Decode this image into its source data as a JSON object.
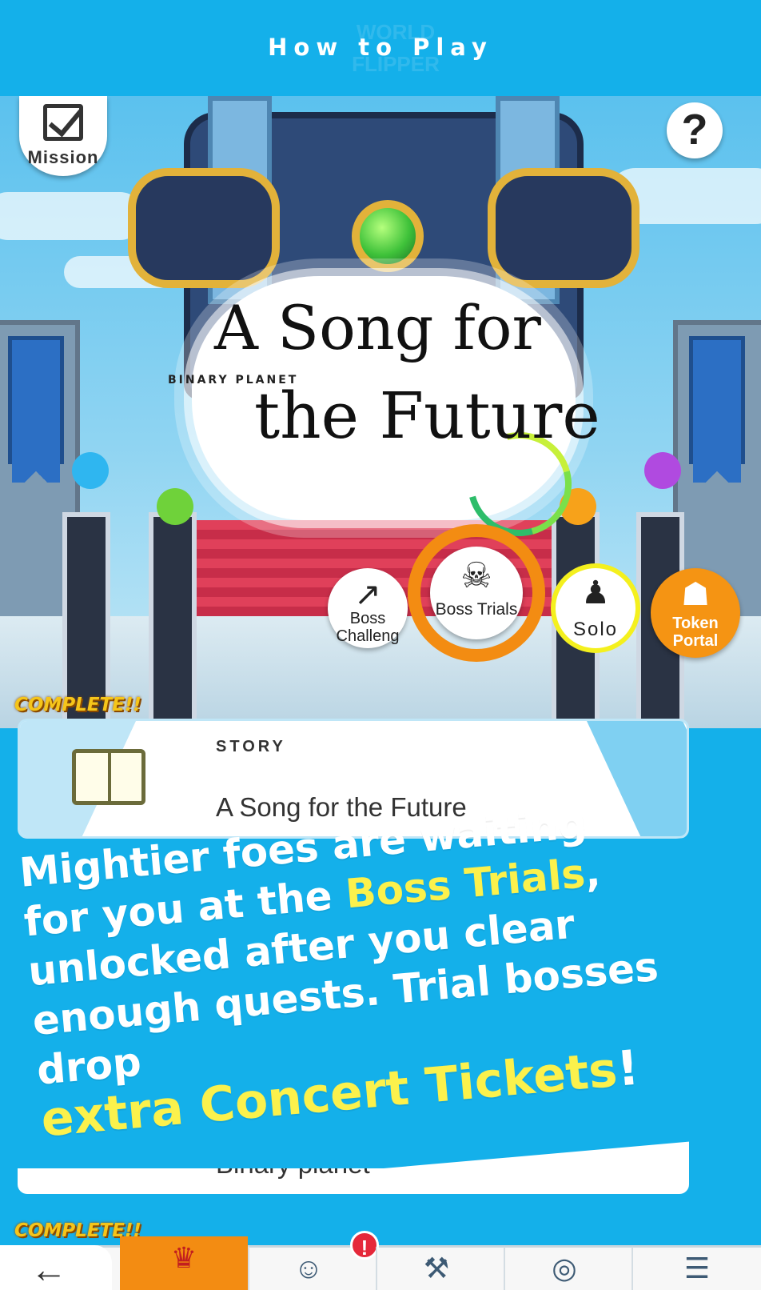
{
  "header": {
    "title": "How to Play",
    "logo_watermark": "WORLD FLIPPER"
  },
  "scene": {
    "mission_label": "Mission",
    "help_icon": "question-icon",
    "title": {
      "line1": "A Song for",
      "subtitle": "BINARY PLANET",
      "line2": "the Future"
    },
    "modes": {
      "boss_challenge": "Boss Challeng",
      "boss_challenge_line1": "Boss",
      "boss_challenge_line2": "Challeng",
      "boss_trials": "Boss Trials",
      "solo": "Solo",
      "token_portal_line1": "Token",
      "token_portal_line2": "Portal"
    }
  },
  "story": {
    "complete_badge": "COMPLETE!!",
    "label": "STORY",
    "title": "A Song for the Future"
  },
  "promo": {
    "line1": "Mightier foes are waiting",
    "line2_pre": "for you at the ",
    "line2_hl": "Boss Trials",
    "line2_post": ",",
    "line3": "unlocked after you clear",
    "line4": "enough quests. Trial bosses drop",
    "line5_hl": "extra Concert Tickets",
    "line5_post": "!"
  },
  "second_card": {
    "title": "Binary planet",
    "complete_badge": "COMPLETE!!"
  },
  "bottom_nav": {
    "back_icon": "back-arrow-icon",
    "alert_badge": "!",
    "colors": {
      "active": "#f38c12",
      "alert": "#e5283a"
    }
  },
  "colors": {
    "accent_blue": "#14b0ea",
    "highlight_yellow": "#fbf14c",
    "boss_trials_ring": "#f38c12",
    "solo_ring": "#f4f01e"
  }
}
